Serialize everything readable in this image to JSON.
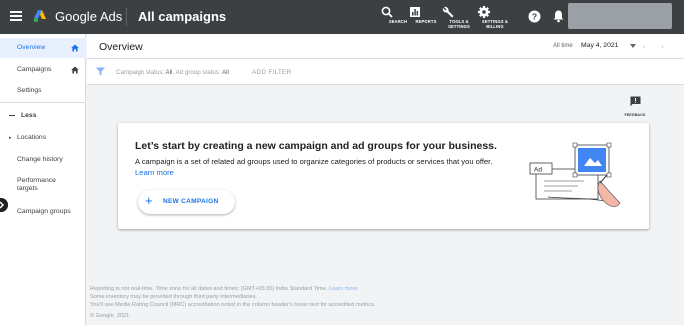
{
  "header": {
    "brand": "Google Ads",
    "page_title": "All campaigns",
    "tools": [
      {
        "label": "SEARCH",
        "icon": "search-icon"
      },
      {
        "label": "REPORTS",
        "icon": "reports-icon"
      },
      {
        "label": "TOOLS &",
        "label2": "SETTINGS",
        "icon": "wrench-icon"
      },
      {
        "label": "SETTINGS &",
        "label2": "BILLING",
        "icon": "gear-icon"
      }
    ],
    "help_icon": "help-icon",
    "notifications_icon": "bell-icon"
  },
  "sidebar": {
    "items": [
      {
        "label": "Overview",
        "active": true
      },
      {
        "label": "Campaigns"
      },
      {
        "label": "Settings"
      },
      {
        "label": "Less"
      },
      {
        "label": "Locations"
      },
      {
        "label": "Change history"
      },
      {
        "label": "Performance",
        "label2": "targets"
      },
      {
        "label": "Campaign groups"
      }
    ]
  },
  "overview": {
    "title": "Overview",
    "date_label": "All time",
    "date_value": "May 4, 2021"
  },
  "filter": {
    "campaign_status_label": "Campaign status:",
    "campaign_status_value": "All",
    "ad_group_status_label": "Ad group status:",
    "ad_group_status_value": "All",
    "add_filter": "ADD FILTER"
  },
  "feedback": {
    "label": "FEEDBACK"
  },
  "card": {
    "title": "Let’s start by creating a new campaign and ad groups for your business.",
    "description": "A campaign is a set of related ad groups used to organize categories of products or services that you offer.",
    "learn_more": "Learn more",
    "button_label": "NEW CAMPAIGN",
    "illustration_tag": "Ad"
  },
  "footer": {
    "line1": "Reporting is not real-time. Time zone for all dates and times: (GMT+05:30) India Standard Time.",
    "line1_link": "Learn more",
    "line2": "Some inventory may be provided through third party intermediaries.",
    "line3": "You'll see Media Rating Council (MRC) accreditation noted in the column header's hover text for accredited metrics.",
    "copyright": "© Google, 2021."
  },
  "colors": {
    "topbar": "#3c4043",
    "accent": "#1a73e8",
    "active_bg": "#e8f0fe"
  }
}
